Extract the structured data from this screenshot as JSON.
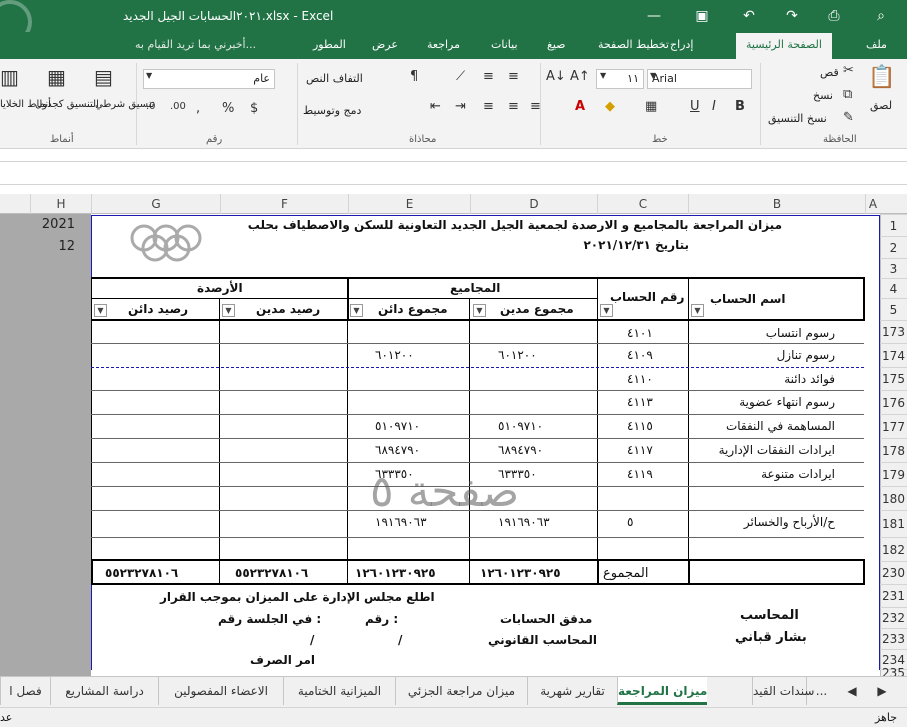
{
  "window": {
    "title": "٢٠٢١الحسابات الجيل الجديد.xlsx - Excel"
  },
  "tabs": {
    "file": "ملف",
    "home": "الصفحة الرئيسية",
    "insert": "إدراج",
    "layout": "تخطيط الصفحة",
    "formulas": "صيغ",
    "data": "بيانات",
    "review": "مراجعة",
    "view": "عرض",
    "developer": "المطور",
    "tell_me": "أخبرني بما تريد القيام به..."
  },
  "ribbon": {
    "paste": "لصق",
    "cut": "قص",
    "copy": "نسخ",
    "format_painter": "نسخ التنسيق",
    "group_clipboard": "الحافظة",
    "font_name": "Arial",
    "font_size": "١١",
    "group_font": "خط",
    "wrap_text": "التفاف النص",
    "merge_center": "دمج وتوسيط",
    "group_alignment": "محاذاة",
    "number_format": "عام",
    "group_number": "رقم",
    "conditional_format": "تنسيق شرطي",
    "format_as_table": "التنسيق كجدول",
    "cell_styles": "أنماط الخلايا",
    "group_styles": "أنماط"
  },
  "columns": [
    "A",
    "C",
    "D",
    "E",
    "F",
    "G",
    "H"
  ],
  "rows": [
    "1",
    "2",
    "3",
    "4",
    "5",
    "173",
    "174",
    "175",
    "176",
    "177",
    "178",
    "179",
    "180",
    "181",
    "182",
    "230",
    "231",
    "232",
    "233",
    "234",
    "235"
  ],
  "col_h": {
    "r1": "2021",
    "r2": "12"
  },
  "report": {
    "title": "ميزان المراجعة بالمجاميع و الارصدة لجمعية الجيل الجديد التعاونية للسكن والاصطياف بحلب",
    "date": "بتاريخ  ٢٠٢١/١٢/٣١",
    "hdr_account_name": "اسم الحساب",
    "hdr_account_no": "رقم الحساب",
    "hdr_totals": "المجاميع",
    "hdr_balances": "الأرصدة",
    "hdr_total_debit": "مجموع مدين",
    "hdr_total_credit": "مجموع دائن",
    "hdr_bal_debit": "رصيد مدين",
    "hdr_bal_credit": "رصيد دائن",
    "rows": [
      {
        "name": "رسوم انتساب",
        "no": "٤١٠١",
        "debit": "",
        "credit": ""
      },
      {
        "name": "رسوم تنازل",
        "no": "٤١٠٩",
        "debit": "٦٠١٢٠٠",
        "credit": "٦٠١٢٠٠"
      },
      {
        "name": "فوائد دائنة",
        "no": "٤١١٠",
        "debit": "",
        "credit": ""
      },
      {
        "name": "رسوم انتهاء عضوية",
        "no": "٤١١٣",
        "debit": "",
        "credit": ""
      },
      {
        "name": "المساهمة في النفقات",
        "no": "٤١١٥",
        "debit": "٥١٠٩٧١٠",
        "credit": "٥١٠٩٧١٠"
      },
      {
        "name": "ايرادات النفقات الإدارية",
        "no": "٤١١٧",
        "debit": "٦٨٩٤٧٩٠",
        "credit": "٦٨٩٤٧٩٠"
      },
      {
        "name": "ايرادات متنوعة",
        "no": "٤١١٩",
        "debit": "٦٣٣٣٥٠",
        "credit": "٦٣٣٣٥٠"
      },
      {
        "name": "",
        "no": "",
        "debit": "",
        "credit": ""
      },
      {
        "name": "ح/الأرباح والخسائر",
        "no": "٥",
        "debit": "١٩١٦٩٠٦٣",
        "credit": "١٩١٦٩٠٦٣"
      },
      {
        "name": "",
        "no": "",
        "debit": "",
        "credit": ""
      }
    ],
    "total_label": "المجموع",
    "total_debit": "١٢٦٠١٢٣٠٩٢٥",
    "total_credit": "١٢٦٠١٢٣٠٩٢٥",
    "total_bal_debit": "٥٥٢٣٢٧٨١٠٦",
    "total_bal_credit": "٥٥٢٣٢٧٨١٠٦",
    "board_note": "اطلع مجلس الإدارة على الميزان بموجب القرار",
    "auditor": "مدقق الحسابات",
    "no_label": "رقم :",
    "session_label": "في الجلسة رقم :",
    "accountant_label": "المحاسب",
    "legal_accountant": "المحاسب القانوني",
    "slash1": "/",
    "slash2": "/",
    "accountant_name": "بشار قباني",
    "payment_order": "امر الصرف",
    "watermark": "صفحة ٥"
  },
  "sheets": [
    "سندات القيد",
    "ميزان المراجعة",
    "تقارير شهرية",
    "ميزان مراجعة الجزئي",
    "الميزانية الختامية",
    "الاعضاء المفصولين",
    "دراسة المشاريع",
    "فصل ا"
  ],
  "active_sheet": "ميزان المراجعة",
  "status": {
    "ready": "جاهز",
    "other": "عد"
  }
}
